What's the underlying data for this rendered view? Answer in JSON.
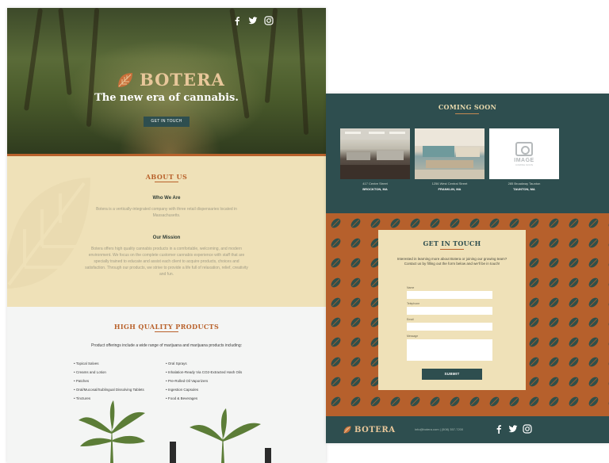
{
  "brand": {
    "name": "BOTERA",
    "tagline": "The new era of cannabis.",
    "accent": "#b9622c",
    "teal": "#2e4e4f",
    "cream": "#efe1b8",
    "gold": "#e8c79a"
  },
  "hero": {
    "cta_label": "GET IN TOUCH",
    "social": [
      "facebook-icon",
      "twitter-icon",
      "instagram-icon"
    ]
  },
  "about": {
    "title": "ABOUT US",
    "who_title": "Who We Are",
    "who_text": "Botera is a vertically-integrated company with three retail dispensaries located in Massachusetts.",
    "mission_title": "Our Mission",
    "mission_text": "Botera offers high quality cannabis products in a comfortable, welcoming, and modern environment. We focus on the complete customer cannabis experience with staff that are specially trained to educate and assist each client to acquire products, choices and satisfaction. Through our products, we strive to provide a life full of relaxation, relief, creativity and fun."
  },
  "products": {
    "title": "HIGH QUALITY PRODUCTS",
    "intro": "Product offerings include a wide range of marijuana and marijuana products including:",
    "col1": [
      "Topical Salves",
      "Creams and Lotion",
      "Patches",
      "Oral/Mucosal/Sublingual Dissolving Tablets",
      "Tinctures"
    ],
    "col2": [
      "Oral Sprays",
      "Inhalation-Ready Via CO2-Extracted Hash Oils",
      "Pre-Rolled Oil Vaporizers",
      "Ingestion Capsules",
      "Food & Beverages"
    ]
  },
  "coming_soon": {
    "title": "COMING SOON",
    "locations": [
      {
        "address": "417 Centre Street",
        "city": "BROCKTON, MA"
      },
      {
        "address": "1256 West Central Street",
        "city": "FRANKLIN, MA"
      },
      {
        "address": "285 Broadway Taunton",
        "city": "TAUNTON, MA"
      }
    ],
    "placeholder_label": "IMAGE",
    "placeholder_sub": "COMING SOON"
  },
  "contact_form": {
    "title": "GET IN TOUCH",
    "description": "Interested in learning more about Botera or joining our growing team? Contact us by filling out the form below and we'll be in touch!",
    "fields": [
      {
        "label": "Name",
        "value": ""
      },
      {
        "label": "Telephone",
        "value": ""
      },
      {
        "label": "Email",
        "value": ""
      },
      {
        "label": "Message",
        "value": ""
      }
    ],
    "submit_label": "SUBMIT"
  },
  "footer": {
    "contact": "info@botera.com | (508) 357-7200",
    "social": [
      "facebook-icon",
      "twitter-icon",
      "instagram-icon"
    ]
  }
}
